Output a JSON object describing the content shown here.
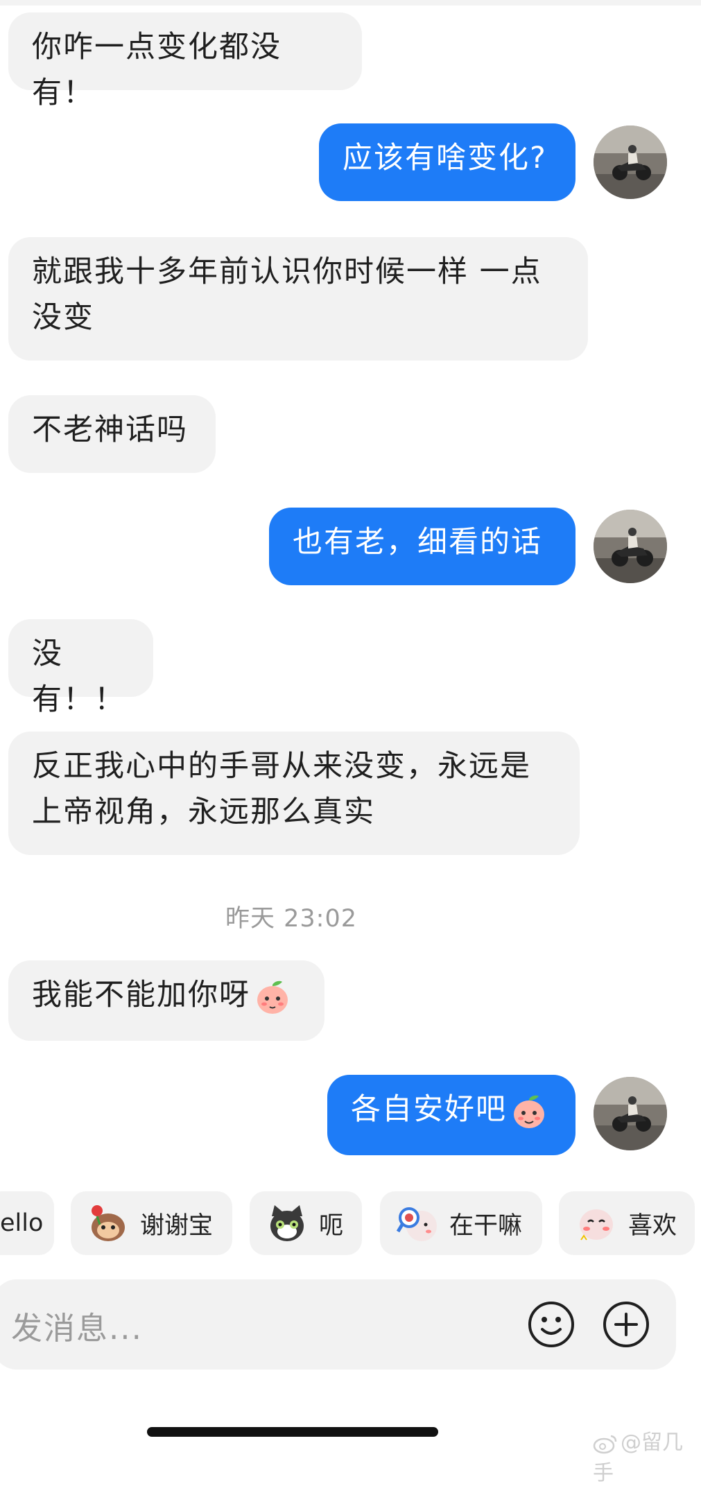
{
  "messages": [
    {
      "text": "你咋一点变化都没有！",
      "side": "in"
    },
    {
      "text": "应该有啥变化?",
      "side": "out"
    },
    {
      "text": "就跟我十多年前认识你时候一样 一点没变",
      "side": "in"
    },
    {
      "text": "不老神话吗",
      "side": "in"
    },
    {
      "text": "也有老，细看的话",
      "side": "out"
    },
    {
      "text": "没有！！",
      "side": "in"
    },
    {
      "text": "反正我心中的手哥从来没变，永远是上帝视角，永远那么真实",
      "side": "in"
    },
    {
      "text": "我能不能加你呀",
      "side": "in"
    },
    {
      "text": "各自安好吧",
      "side": "out"
    }
  ],
  "timestamp": "昨天 23:02",
  "quick_replies": [
    {
      "label": "ello",
      "icon": "none"
    },
    {
      "label": "谢谢宝",
      "icon": "monkey-flower-sticker-icon"
    },
    {
      "label": "呃",
      "icon": "cat-sticker-icon"
    },
    {
      "label": "在干嘛",
      "icon": "magnifier-sticker-icon"
    },
    {
      "label": "喜欢",
      "icon": "blush-sticker-icon"
    }
  ],
  "composer": {
    "placeholder": "发消息..."
  },
  "watermark": "@留几手",
  "colors": {
    "outgoing": "#1e7cf7",
    "incoming": "#f2f2f2",
    "timestamp": "#9a9a9a"
  }
}
